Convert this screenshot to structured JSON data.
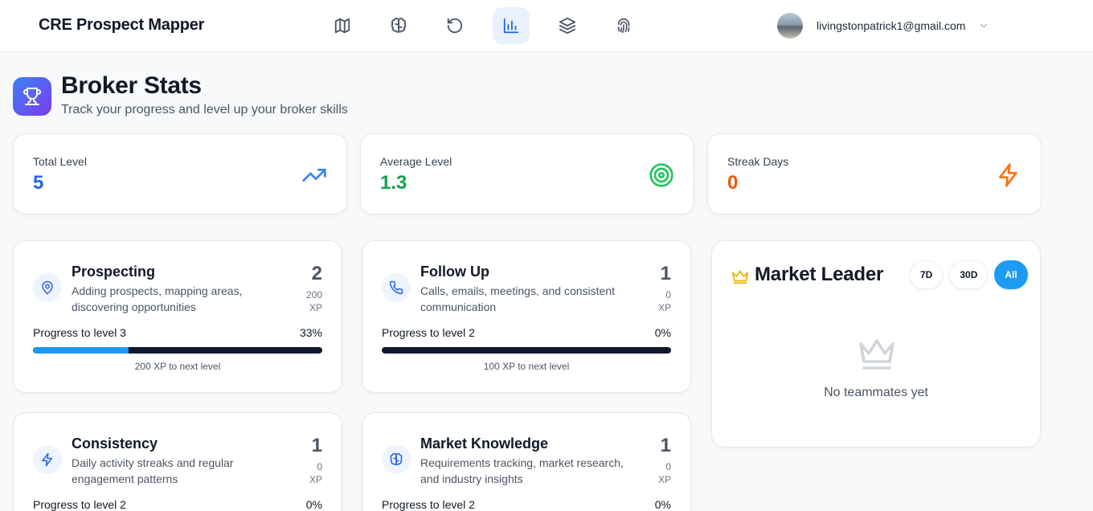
{
  "app": {
    "title": "CRE Prospect Mapper"
  },
  "nav": [
    {
      "icon": "map-icon",
      "active": false
    },
    {
      "icon": "brain-icon",
      "active": false
    },
    {
      "icon": "history-icon",
      "active": false
    },
    {
      "icon": "bar-chart-icon",
      "active": true
    },
    {
      "icon": "layers-icon",
      "active": false
    },
    {
      "icon": "fingerprint-icon",
      "active": false
    }
  ],
  "user": {
    "email": "livingstonpatrick1@gmail.com"
  },
  "header": {
    "title": "Broker Stats",
    "subtitle": "Track your progress and level up your broker skills"
  },
  "stats": [
    {
      "label": "Total Level",
      "value": "5",
      "color": "#2563eb",
      "icon": "trending-up-icon"
    },
    {
      "label": "Average Level",
      "value": "1.3",
      "color": "#16a34a",
      "icon": "target-icon"
    },
    {
      "label": "Streak Days",
      "value": "0",
      "color": "#ea580c",
      "icon": "lightning-icon"
    }
  ],
  "skills": [
    {
      "title": "Prospecting",
      "description": "Adding prospects, mapping areas, discovering opportunities",
      "level": "2",
      "xp": "200",
      "xp_unit": "XP",
      "progress_label": "Progress to level 3",
      "progress_pct": "33%",
      "progress": 0.33,
      "note": "200 XP to next level",
      "icon": "map-pin-icon"
    },
    {
      "title": "Follow Up",
      "description": "Calls, emails, meetings, and consistent communication",
      "level": "1",
      "xp": "0",
      "xp_unit": "XP",
      "progress_label": "Progress to level 2",
      "progress_pct": "0%",
      "progress": 0,
      "note": "100 XP to next level",
      "icon": "phone-icon"
    },
    {
      "title": "Consistency",
      "description": "Daily activity streaks and regular engagement patterns",
      "level": "1",
      "xp": "0",
      "xp_unit": "XP",
      "progress_label": "Progress to level 2",
      "progress_pct": "0%",
      "progress": 0,
      "icon": "lightning-icon"
    },
    {
      "title": "Market Knowledge",
      "description": "Requirements tracking, market research, and industry insights",
      "level": "1",
      "xp": "0",
      "xp_unit": "XP",
      "progress_label": "Progress to level 2",
      "progress_pct": "0%",
      "progress": 0,
      "icon": "brain-icon"
    }
  ],
  "leaderboard": {
    "title": "Market Leader",
    "filters": [
      {
        "label": "7D",
        "active": false
      },
      {
        "label": "30D",
        "active": false
      },
      {
        "label": "All",
        "active": true
      }
    ],
    "empty_text": "No teammates yet"
  }
}
